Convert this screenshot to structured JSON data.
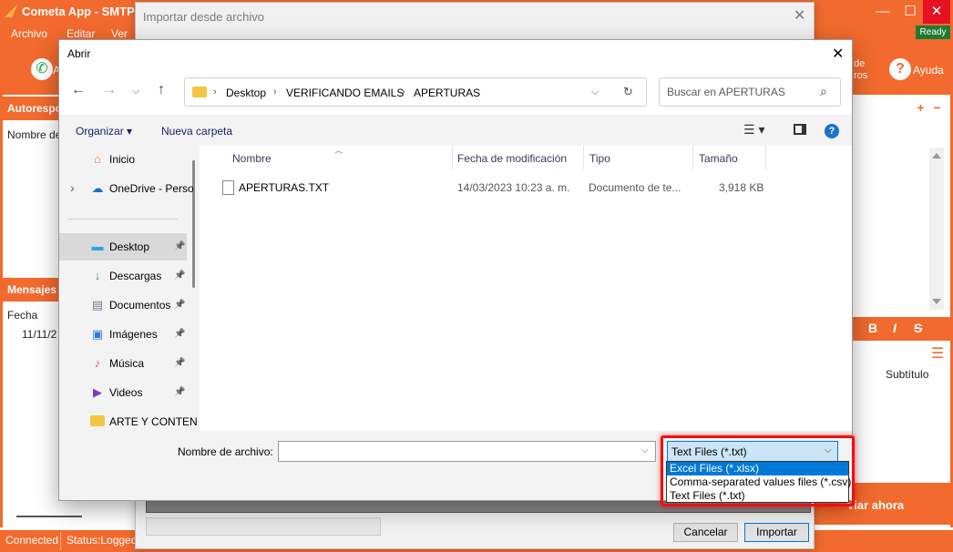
{
  "app": {
    "title": "Cometa App - SMTPs",
    "menu": [
      "Archivo",
      "Editar",
      "Ver"
    ],
    "ready": "Ready",
    "toolbar_partial": "de\nros",
    "help_label": "Ayuda",
    "auto_label": "Autorespo",
    "name_label": "Nombre de",
    "messages_label": "Mensajes",
    "date_label": "Fecha",
    "date_value": "11/11/2",
    "subtitle_label": "Subtítulo",
    "send_label": "viar ahora",
    "status": [
      "Connected",
      "Status:Loggedi"
    ],
    "fmt": [
      "B",
      "I",
      "S"
    ]
  },
  "import_dialog": {
    "title": "Importar desde archivo",
    "cancel": "Cancelar",
    "import": "Importar"
  },
  "open_dialog": {
    "title": "Abrir",
    "breadcrumb": [
      "Desktop",
      "VERIFICANDO EMAILS",
      "APERTURAS"
    ],
    "search_placeholder": "Buscar en APERTURAS",
    "organize": "Organizar ▾",
    "new_folder": "Nueva carpeta",
    "nav": [
      {
        "label": "Inicio",
        "icon": "home-icon",
        "glyph": "⌂",
        "color": "#e07b39",
        "pin": false
      },
      {
        "label": "OneDrive - Perso",
        "icon": "cloud-icon",
        "glyph": "☁",
        "color": "#1a73c9",
        "pin": false
      },
      {
        "label": "Desktop",
        "icon": "desktop-icon",
        "glyph": "▬",
        "color": "#2aa3e0",
        "pin": true
      },
      {
        "label": "Descargas",
        "icon": "download-icon",
        "glyph": "↓",
        "color": "#2a9d5c",
        "pin": true
      },
      {
        "label": "Documentos",
        "icon": "document-icon",
        "glyph": "▤",
        "color": "#6b7b8c",
        "pin": true
      },
      {
        "label": "Imágenes",
        "icon": "image-icon",
        "glyph": "▣",
        "color": "#2b7fd0",
        "pin": true
      },
      {
        "label": "Música",
        "icon": "music-icon",
        "glyph": "♪",
        "color": "#e0506a",
        "pin": true
      },
      {
        "label": "Videos",
        "icon": "video-icon",
        "glyph": "▶",
        "color": "#7a3cc9",
        "pin": true
      },
      {
        "label": "ARTE Y CONTEN",
        "icon": "folder-icon",
        "glyph": "",
        "color": "#f4c542",
        "pin": false
      }
    ],
    "columns": [
      "Nombre",
      "Fecha de modificación",
      "Tipo",
      "Tamaño"
    ],
    "files": [
      {
        "name": "APERTURAS.TXT",
        "date": "14/03/2023 10:23 a. m.",
        "type": "Documento de te...",
        "size": "3,918 KB"
      }
    ],
    "filename_label": "Nombre de archivo:",
    "filename_value": "",
    "filter_selected": "Text Files (*.txt)",
    "filter_options": [
      "Excel Files (*.xlsx)",
      "Comma-separated values files (*.csv)",
      "Text Files (*.txt)"
    ]
  },
  "colors": {
    "accent": "#f26a2d",
    "selection": "#0078d7",
    "highlight": "#f01010"
  }
}
